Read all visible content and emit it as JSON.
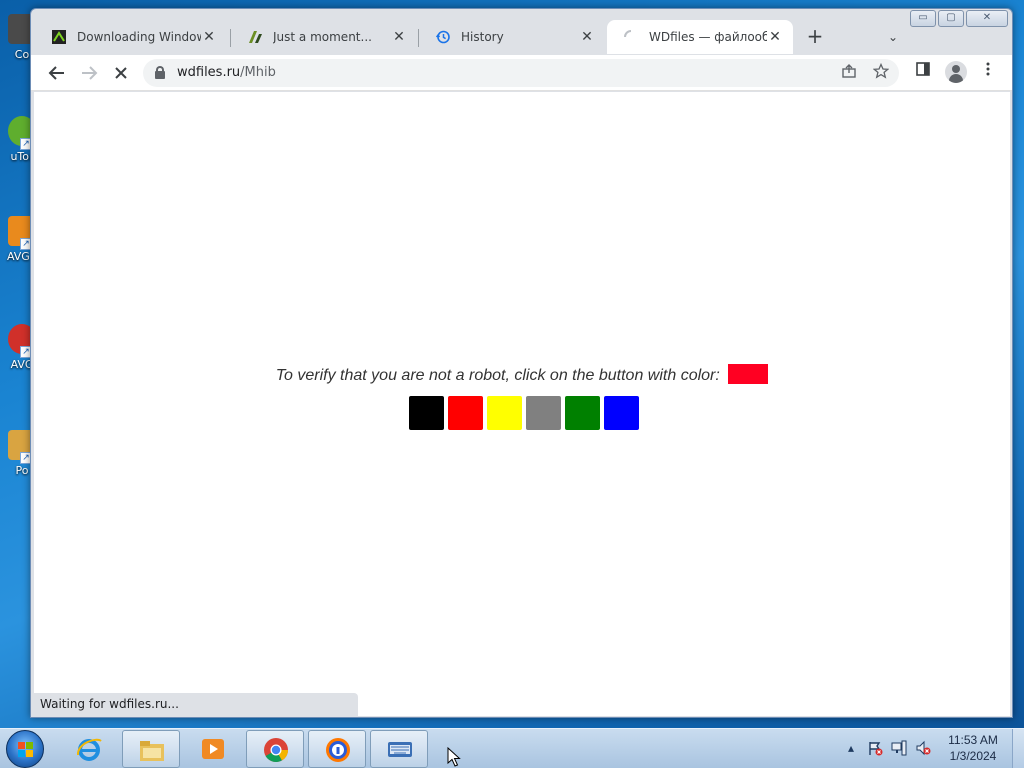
{
  "desktop": {
    "icons": [
      {
        "label": "Co",
        "color": "#4a4a4a"
      },
      {
        "label": "uTor",
        "color": "#5fae2e"
      },
      {
        "label": "AVG /",
        "color": "#e98a1d"
      },
      {
        "label": "AVG",
        "color": "#d0302a"
      },
      {
        "label": "Po",
        "color": "#d9a441"
      }
    ]
  },
  "browser": {
    "tabs": [
      {
        "title": "Downloading Windows",
        "icon": "download-page-favicon",
        "active": false
      },
      {
        "title": "Just a moment...",
        "icon": "cloudflare-favicon",
        "active": false
      },
      {
        "title": "History",
        "icon": "history-icon",
        "active": false
      },
      {
        "title": "WDfiles — файлообме",
        "icon": "loading-spinner-icon",
        "active": true
      }
    ],
    "new_tab_symbol": "+",
    "tab_search_symbol": "⌄",
    "window_controls": {
      "minimize": "▭",
      "maximize": "▢",
      "close": "✕"
    },
    "url": {
      "host": "wdfiles.ru",
      "path": "/Mhib"
    },
    "status_text": "Waiting for wdfiles.ru..."
  },
  "page": {
    "verify_prompt": "To verify that you are not a robot, click on the button with color:",
    "target_color": "#ff0022",
    "color_buttons": [
      {
        "name": "black",
        "color": "#000000"
      },
      {
        "name": "red",
        "color": "#ff0000"
      },
      {
        "name": "yellow",
        "color": "#ffff00"
      },
      {
        "name": "gray",
        "color": "#808080"
      },
      {
        "name": "green",
        "color": "#008000"
      },
      {
        "name": "blue",
        "color": "#0000ff"
      }
    ]
  },
  "taskbar": {
    "apps": [
      {
        "name": "internet-explorer",
        "open": false
      },
      {
        "name": "file-explorer",
        "open": true
      },
      {
        "name": "media-player",
        "open": false
      },
      {
        "name": "chrome",
        "open": true
      },
      {
        "name": "avast-secure-browser",
        "open": true
      },
      {
        "name": "on-screen-keyboard",
        "open": true
      }
    ],
    "clock": {
      "time": "11:53 AM",
      "date": "1/3/2024"
    }
  }
}
